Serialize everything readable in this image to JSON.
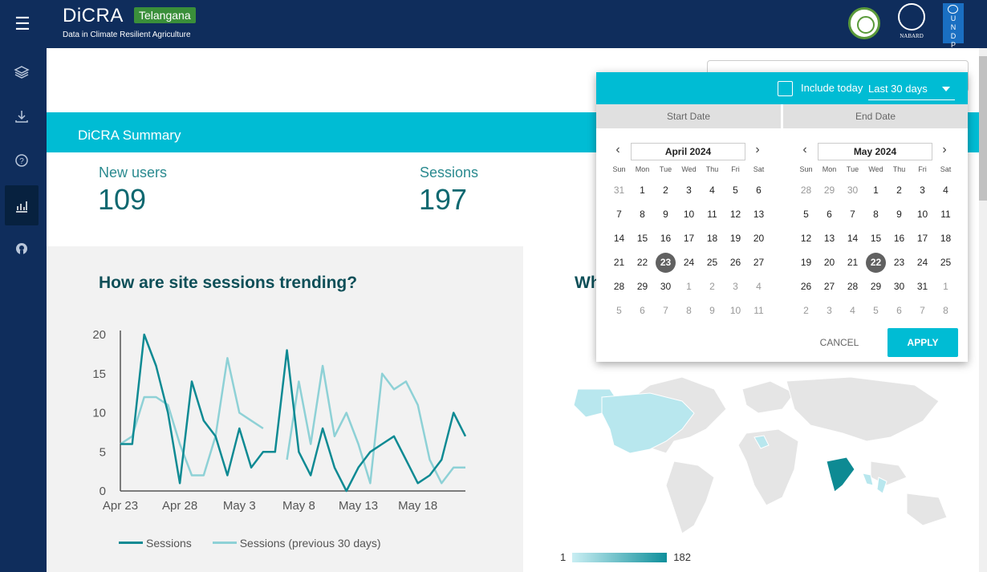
{
  "header": {
    "app_name": "DiCRA",
    "state_badge": "Telangana",
    "tagline": "Data in Climate Resilient Agriculture",
    "nabard_label": "NABARD",
    "undp_letters": "U N D P"
  },
  "sidebar": {
    "items": [
      {
        "icon": "layers-icon"
      },
      {
        "icon": "download-icon"
      },
      {
        "icon": "help-icon"
      },
      {
        "icon": "analytics-icon",
        "active": true
      },
      {
        "icon": "github-icon"
      }
    ]
  },
  "summary": {
    "title": "DiCRA Summary",
    "new_users_label": "New users",
    "new_users_value": "109",
    "sessions_label": "Sessions",
    "sessions_value": "197"
  },
  "sessions_chart": {
    "title": "How are site sessions trending?",
    "legend_current": "Sessions",
    "legend_previous": "Sessions (previous 30 days)"
  },
  "map_panel": {
    "title_visible": "Wh",
    "scale_min": "1",
    "scale_max": "182"
  },
  "date_picker": {
    "include_today_label": "Include today",
    "range_label": "Last 30 days",
    "start_tab": "Start Date",
    "end_tab": "End Date",
    "weekdays": [
      "Sun",
      "Mon",
      "Tue",
      "Wed",
      "Thu",
      "Fri",
      "Sat"
    ],
    "left_month": "April 2024",
    "right_month": "May 2024",
    "left_weeks": [
      [
        "31",
        "1",
        "2",
        "3",
        "4",
        "5",
        "6"
      ],
      [
        "7",
        "8",
        "9",
        "10",
        "11",
        "12",
        "13"
      ],
      [
        "14",
        "15",
        "16",
        "17",
        "18",
        "19",
        "20"
      ],
      [
        "21",
        "22",
        "23",
        "24",
        "25",
        "26",
        "27"
      ],
      [
        "28",
        "29",
        "30",
        "1",
        "2",
        "3",
        "4"
      ],
      [
        "5",
        "6",
        "7",
        "8",
        "9",
        "10",
        "11"
      ]
    ],
    "left_other_month": [
      [
        0
      ],
      [],
      [],
      [],
      [
        3,
        4,
        5,
        6
      ],
      [
        0,
        1,
        2,
        3,
        4,
        5,
        6
      ]
    ],
    "left_selected": [
      3,
      2
    ],
    "right_weeks": [
      [
        "28",
        "29",
        "30",
        "1",
        "2",
        "3",
        "4"
      ],
      [
        "5",
        "6",
        "7",
        "8",
        "9",
        "10",
        "11"
      ],
      [
        "12",
        "13",
        "14",
        "15",
        "16",
        "17",
        "18"
      ],
      [
        "19",
        "20",
        "21",
        "22",
        "23",
        "24",
        "25"
      ],
      [
        "26",
        "27",
        "28",
        "29",
        "30",
        "31",
        "1"
      ],
      [
        "2",
        "3",
        "4",
        "5",
        "6",
        "7",
        "8"
      ]
    ],
    "right_other_month": [
      [
        0,
        1,
        2
      ],
      [],
      [],
      [],
      [
        6
      ],
      [
        0,
        1,
        2,
        3,
        4,
        5,
        6
      ]
    ],
    "right_selected": [
      3,
      3
    ],
    "cancel_label": "CANCEL",
    "apply_label": "APPLY"
  },
  "colors": {
    "accent": "#00bcd4",
    "navy": "#0f2d5c",
    "series_current": "#0e8a93",
    "series_previous": "#8ed1d6"
  },
  "chart_data": {
    "type": "line",
    "title": "How are site sessions trending?",
    "x_tick_labels": [
      "Apr 23",
      "Apr 28",
      "May 3",
      "May 8",
      "May 13",
      "May 18"
    ],
    "ylim": [
      0,
      20
    ],
    "y_ticks": [
      0,
      5,
      10,
      15,
      20
    ],
    "series": [
      {
        "name": "Sessions",
        "values": [
          6,
          6,
          20,
          16,
          10,
          1,
          14,
          9,
          7,
          2,
          8,
          3,
          5,
          5,
          18,
          5,
          2,
          8,
          3,
          0,
          3,
          5,
          6,
          7,
          4,
          1,
          2,
          4,
          10,
          7
        ]
      },
      {
        "name": "Sessions (previous 30 days)",
        "values": [
          6,
          7,
          12,
          12,
          11,
          6,
          2,
          2,
          7,
          17,
          10,
          9,
          8,
          null,
          4,
          14,
          6,
          16,
          7,
          10,
          6,
          1,
          15,
          13,
          14,
          11,
          4,
          1,
          3,
          3
        ]
      }
    ],
    "grid": false,
    "legend": "bottom"
  }
}
